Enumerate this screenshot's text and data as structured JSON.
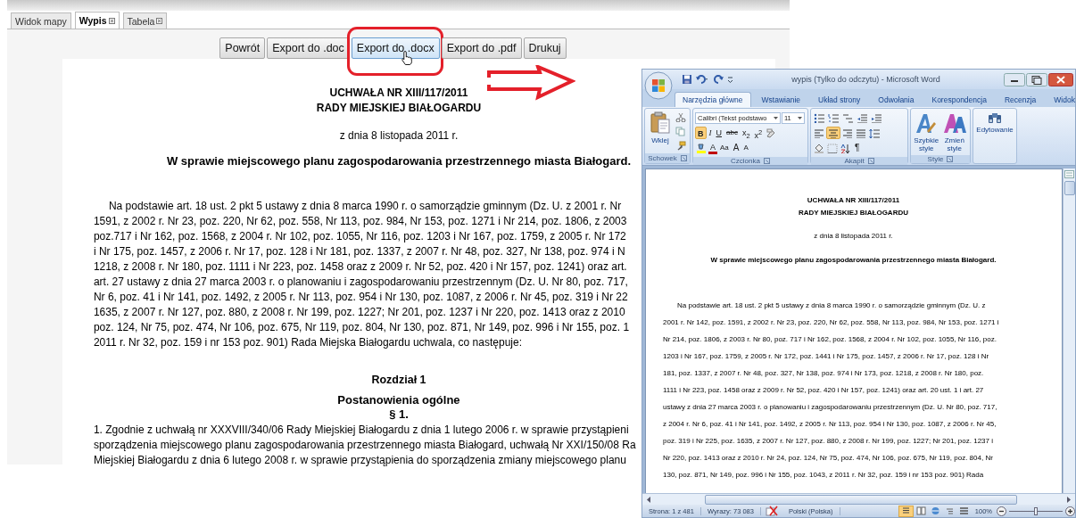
{
  "web_page": {
    "tabs": [
      {
        "label": "Widok mapy",
        "selected": false,
        "closable": false
      },
      {
        "label": "Wypis",
        "selected": true,
        "closable": true
      },
      {
        "label": "Tabela",
        "selected": false,
        "closable": true
      }
    ],
    "toolbar": [
      {
        "label": "Powrót",
        "highlighted": false
      },
      {
        "label": "Export do .doc",
        "highlighted": false
      },
      {
        "label": "Export do .docx",
        "highlighted": true
      },
      {
        "label": "Export do .pdf",
        "highlighted": false
      },
      {
        "label": "Drukuj",
        "highlighted": false
      }
    ],
    "document": {
      "heading": [
        "UCHWAŁA NR XIII/117/2011",
        "RADY MIEJSKIEJ BIAŁOGARDU"
      ],
      "date": "z dnia 8 listopada 2011 r.",
      "subject": "W sprawie miejscowego planu zagospodarowania przestrzennego miasta Białogard.",
      "preamble": [
        "Na podstawie art. 18 ust. 2 pkt 5 ustawy z dnia 8 marca 1990 r. o samorządzie gminnym (Dz. U. z 2001 r. Nr",
        "1591, z 2002 r. Nr 23, poz. 220, Nr 62, poz. 558, Nr 113, poz. 984, Nr 153, poz. 1271 i Nr 214, poz. 1806, z 2003",
        "poz.717 i Nr 162, poz. 1568, z 2004 r. Nr 102, poz. 1055, Nr 116, poz. 1203 i Nr 167, poz. 1759, z 2005 r. Nr 172",
        "i Nr 175, poz. 1457, z 2006 r. Nr 17, poz. 128 i Nr 181, poz. 1337, z 2007 r. Nr 48, poz. 327, Nr 138, poz. 974 i N",
        "1218, z 2008 r. Nr 180, poz. 1111 i Nr 223, poz. 1458 oraz z 2009 r. Nr 52, poz. 420 i Nr 157, poz. 1241) oraz art.",
        "art. 27 ustawy z dnia 27 marca 2003 r. o planowaniu i zagospodarowaniu przestrzennym (Dz. U. Nr 80, poz. 717,",
        "Nr 6, poz. 41 i Nr 141, poz. 1492, z 2005 r. Nr 113, poz. 954 i Nr 130, poz. 1087, z 2006 r. Nr 45, poz. 319 i Nr 22",
        "1635, z 2007 r. Nr 127, poz. 880, z 2008 r. Nr 199, poz. 1227; Nr 201, poz. 1237 i Nr 220, poz. 1413 oraz z 2010",
        "poz. 124, Nr 75, poz. 474, Nr 106, poz. 675, Nr 119, poz. 804, Nr 130, poz. 871, Nr 149, poz. 996 i Nr 155, poz. 1",
        "2011 r. Nr 32, poz. 159 i nr 153 poz. 901) Rada Miejska Białogardu uchwala, co następuje:"
      ],
      "chapter": "Rozdział 1",
      "chapter_title": "Postanowienia ogólne",
      "section": "§ 1.",
      "section_text": [
        "1. Zgodnie z uchwałą nr XXXVIII/340/06 Rady Miejskiej Białogardu z dnia 1 lutego 2006 r. w sprawie przystąpieni",
        "sporządzenia miejscowego planu zagospodarowania przestrzennego miasta Białogard, uchwałą Nr XXI/150/08 Ra",
        "Miejskiej Białogardu z dnia 6 lutego 2008 r. w sprawie przystąpienia do sporządzenia zmiany miejscowego planu"
      ]
    }
  },
  "word_window": {
    "title": "wypis (Tylko do odczytu) - Microsoft Word",
    "ribbon_tabs": [
      {
        "label": "Narzędzia główne",
        "selected": true
      },
      {
        "label": "Wstawianie",
        "selected": false
      },
      {
        "label": "Układ strony",
        "selected": false
      },
      {
        "label": "Odwołania",
        "selected": false
      },
      {
        "label": "Korespondencja",
        "selected": false
      },
      {
        "label": "Recenzja",
        "selected": false
      },
      {
        "label": "Widok",
        "selected": false
      }
    ],
    "ribbon": {
      "clipboard": {
        "paste_label": "Wklej",
        "group_label": "Schowek"
      },
      "font": {
        "name": "Calibri (Tekst podstawo",
        "size": "11",
        "format_buttons": [
          {
            "label": "B",
            "selected": true
          },
          {
            "label": "I",
            "selected": false
          },
          {
            "label": "U",
            "selected": false
          },
          {
            "label": "abc",
            "selected": false
          },
          {
            "label": "x$_{2}$",
            "selected": false
          },
          {
            "label": "x$^{2}$",
            "selected": false
          }
        ],
        "second_row": [
          {
            "label": "A",
            "kind": "color"
          },
          {
            "label": "Aa",
            "kind": "case"
          },
          {
            "label": "A",
            "kind": "grow"
          },
          {
            "label": "A",
            "kind": "shrink"
          }
        ],
        "group_label": "Czcionka"
      },
      "paragraph": {
        "align_buttons": [
          {
            "selected": false
          },
          {
            "selected": true
          },
          {
            "selected": false
          },
          {
            "selected": false
          }
        ],
        "pilcrow": "¶",
        "group_label": "Akapit"
      },
      "styles": {
        "buttons": [
          "Szybkie style",
          "Zmień style"
        ],
        "group_label": "Style"
      },
      "editing": {
        "label": "Edytowanie"
      }
    },
    "document": {
      "heading": [
        "UCHWAŁA NR XIII/117/2011",
        "RADY MIEJSKIEJ BIAŁOGARDU"
      ],
      "date": "z dnia 8 listopada 2011 r.",
      "subject": "W sprawie miejscowego planu zagospodarowania przestrzennego miasta Białogard.",
      "body_lines": [
        "Na podstawie art. 18 ust. 2 pkt 5 ustawy z dnia 8 marca 1990 r. o samorządzie gminnym (Dz. U. z",
        "2001 r. Nr 142, poz. 1591, z 2002 r. Nr 23, poz. 220, Nr 62, poz. 558, Nr 113, poz. 984, Nr 153, poz. 1271 i",
        "Nr 214, poz. 1806, z 2003 r. Nr 80, poz. 717 i Nr 162, poz. 1568, z 2004 r. Nr 102, poz. 1055, Nr 116, poz.",
        "1203 i Nr 167, poz. 1759, z 2005 r. Nr 172, poz. 1441 i Nr 175, poz. 1457, z 2006 r. Nr 17, poz. 128 i Nr",
        "181, poz. 1337, z 2007 r. Nr 48, poz. 327, Nr 138, poz. 974 i Nr 173, poz. 1218, z 2008 r. Nr 180, poz.",
        "1111 i Nr 223, poz. 1458 oraz z 2009 r. Nr 52, poz. 420 i Nr 157, poz. 1241) oraz art. 20 ust. 1 i art. 27",
        "ustawy z dnia 27 marca 2003 r. o planowaniu i zagospodarowaniu przestrzennym (Dz. U. Nr 80, poz. 717,",
        "z 2004 r. Nr 6, poz. 41 i Nr 141, poz. 1492, z 2005 r. Nr 113, poz. 954 i Nr 130, poz. 1087, z 2006 r. Nr 45,",
        "poz. 319 i Nr 225, poz. 1635, z 2007 r. Nr 127, poz. 880, z 2008 r. Nr 199, poz. 1227; Nr 201, poz. 1237 i",
        "Nr 220, poz. 1413 oraz z 2010 r. Nr 24, poz. 124, Nr 75, poz. 474, Nr 106, poz. 675, Nr 119, poz. 804, Nr",
        "130, poz. 871, Nr 149, poz. 996 i Nr 155, poz. 1043, z 2011 r. Nr 32, poz. 159 i nr 153 poz. 901) Rada"
      ]
    },
    "status_bar": {
      "page": "Strona: 1 z 481",
      "words": "Wyrazy: 73 083",
      "language": "Polski (Polska)",
      "views": [
        {
          "selected": true
        },
        {
          "selected": false
        },
        {
          "selected": false
        },
        {
          "selected": false
        },
        {
          "selected": false
        }
      ],
      "zoom": "100%",
      "zoom_slider": {
        "level": 0.5
      }
    }
  }
}
